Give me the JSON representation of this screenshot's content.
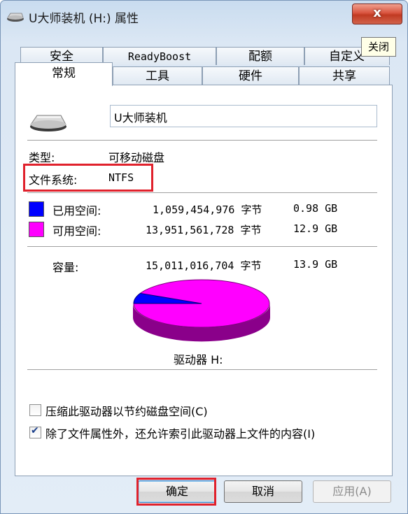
{
  "window": {
    "title": "U大师装机 (H:) 属性",
    "close_label": "x",
    "close_tooltip": "关闭"
  },
  "tabs": {
    "row_back": [
      "安全",
      "ReadyBoost",
      "配额",
      "自定义"
    ],
    "row_front": [
      "常规",
      "工具",
      "硬件",
      "共享"
    ],
    "active": "常规"
  },
  "general": {
    "volume_name": "U大师装机",
    "type_label": "类型:",
    "type_value": "可移动磁盘",
    "fs_label": "文件系统:",
    "fs_value": "NTFS",
    "used": {
      "label": "已用空间:",
      "bytes": "1,059,454,976 字节",
      "size": "0.98 GB",
      "color": "#0000ff"
    },
    "free": {
      "label": "可用空间:",
      "bytes": "13,951,561,728 字节",
      "size": "12.9 GB",
      "color": "#ff00ff"
    },
    "capacity": {
      "label": "容量:",
      "bytes": "15,011,016,704 字节",
      "size": "13.9 GB"
    },
    "drive_label": "驱动器 H:",
    "used_fraction": 0.0706
  },
  "options": [
    {
      "label": "压缩此驱动器以节约磁盘空间(C)",
      "checked": false
    },
    {
      "label": "除了文件属性外，还允许索引此驱动器上文件的内容(I)",
      "checked": true
    }
  ],
  "buttons": {
    "ok": "确定",
    "cancel": "取消",
    "apply": "应用(A)"
  },
  "colors": {
    "highlight": "#e0212c",
    "used": "#0000ff",
    "free": "#ff00ff"
  }
}
